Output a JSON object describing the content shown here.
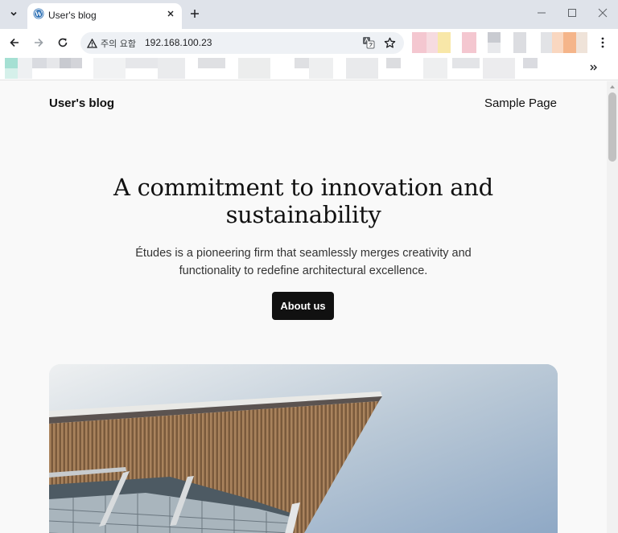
{
  "browser": {
    "tab_title": "User's blog",
    "security_warning": "주의 요함",
    "url": "192.168.100.23"
  },
  "site": {
    "title": "User's blog",
    "nav": [
      "Sample Page"
    ]
  },
  "hero": {
    "heading": "A commitment to innovation and sustainability",
    "body": "Études is a pioneering firm that seamlessly merges creativity and functionality to redefine architectural excellence.",
    "button_label": "About us"
  },
  "icons": {
    "tab_list": "chevron-down-icon",
    "favicon": "wordpress-icon",
    "tab_close": "close-icon",
    "new_tab": "plus-icon",
    "back": "back-arrow-icon",
    "forward": "forward-arrow-icon",
    "reload": "reload-icon",
    "warning": "warning-triangle-icon",
    "translate": "translate-icon",
    "bookmark": "star-icon",
    "menu": "kebab-menu-icon",
    "more_bookmarks": "double-chevron-icon"
  },
  "colors": {
    "tab_strip": "#dfe3ea",
    "page_background": "#f9f9f9",
    "button": "#111111",
    "sky": "#8ea8c6"
  }
}
